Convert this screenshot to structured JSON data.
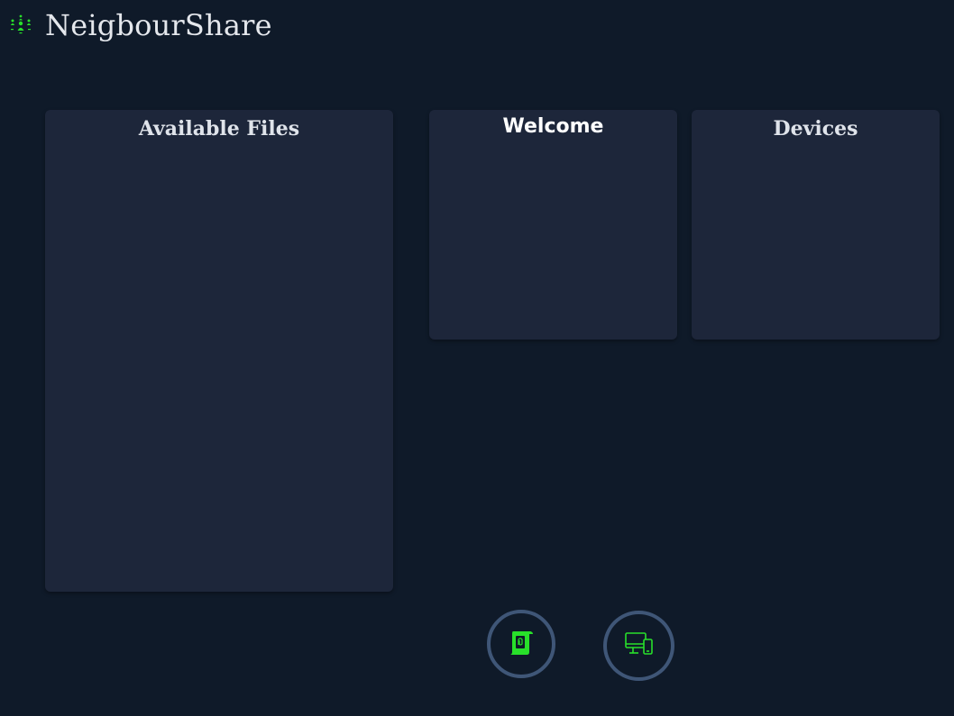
{
  "app": {
    "title": "NeigbourShare",
    "logo_icon": "people-network-icon",
    "accent_color": "#28e02a"
  },
  "panels": {
    "files": {
      "title": "Available Files",
      "items": []
    },
    "welcome": {
      "title": "Welcome"
    },
    "devices": {
      "title": "Devices",
      "items": []
    }
  },
  "actions": {
    "files_button_icon": "scroll-file-icon",
    "devices_button_icon": "devices-icon"
  }
}
